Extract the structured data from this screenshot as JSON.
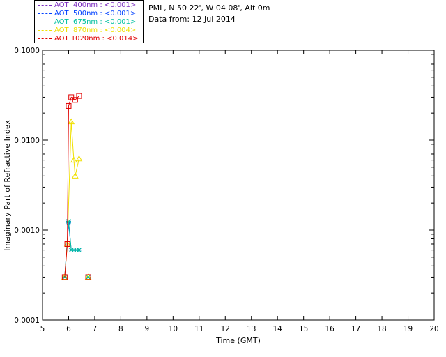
{
  "legend": [
    {
      "text": "AOT  400nm : <0.001>",
      "color": "#7b2cbf"
    },
    {
      "text": "AOT  500nm : <0.001>",
      "color": "#0040ff"
    },
    {
      "text": "AOT  675nm : <0.001>",
      "color": "#00c0a0"
    },
    {
      "text": "AOT  870nm : <0.004>",
      "color": "#f0e000"
    },
    {
      "text": "AOT 1020nm : <0.014>",
      "color": "#e00000"
    }
  ],
  "info": {
    "line1": "PML, N 50 22', W 04 08', Alt 0m",
    "line2": "Data from: 12 Jul 2014"
  },
  "chart_data": {
    "type": "line",
    "xlabel": "Time (GMT)",
    "ylabel": "Imaginary Part of Refractive Index",
    "xlim": [
      5,
      20
    ],
    "ylim": [
      0.0001,
      0.1
    ],
    "yscale": "log",
    "x_ticks": [
      "5",
      "6",
      "7",
      "8",
      "9",
      "10",
      "11",
      "12",
      "13",
      "14",
      "15",
      "16",
      "17",
      "18",
      "19",
      "20"
    ],
    "y_ticks": [
      "0.0001",
      "0.0010",
      "0.0100",
      "0.1000"
    ],
    "series": [
      {
        "name": "AOT  400nm",
        "color": "#7b2cbf",
        "marker": "x",
        "x": [
          5.85,
          6.75
        ],
        "y": [
          0.0003,
          0.0003
        ]
      },
      {
        "name": "AOT  500nm",
        "color": "#0040ff",
        "marker": "x",
        "x": [
          5.85,
          6.0,
          6.1,
          6.2,
          6.3,
          6.4,
          6.75
        ],
        "y": [
          0.0003,
          0.0012,
          0.0006,
          0.0006,
          0.0006,
          0.0006,
          0.0003
        ]
      },
      {
        "name": "AOT  675nm",
        "color": "#00c0a0",
        "marker": "x",
        "x": [
          5.85,
          6.0,
          6.1,
          6.2,
          6.3,
          6.4,
          6.75
        ],
        "y": [
          0.0003,
          0.00125,
          0.0006,
          0.0006,
          0.0006,
          0.0006,
          0.0003
        ]
      },
      {
        "name": "AOT  870nm",
        "color": "#f0e000",
        "marker": "triangle",
        "x": [
          5.85,
          5.95,
          6.1,
          6.2,
          6.25,
          6.4,
          6.75
        ],
        "y": [
          0.0003,
          0.0007,
          0.016,
          0.006,
          0.004,
          0.0062,
          0.0003
        ]
      },
      {
        "name": "AOT 1020nm",
        "color": "#e00000",
        "marker": "square",
        "x": [
          5.85,
          5.95,
          6.0,
          6.1,
          6.25,
          6.4,
          6.75
        ],
        "y": [
          0.0003,
          0.0007,
          0.024,
          0.03,
          0.028,
          0.031,
          0.0003
        ]
      }
    ]
  }
}
